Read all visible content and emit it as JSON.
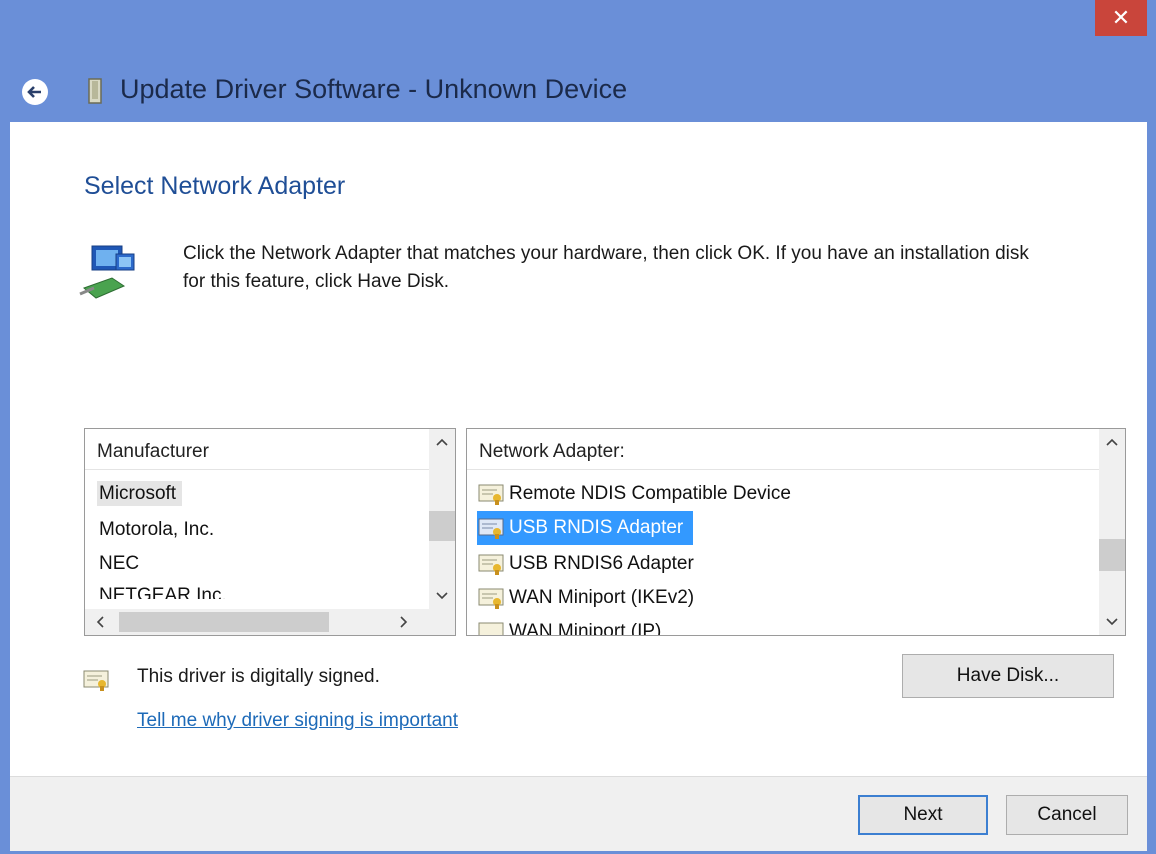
{
  "window": {
    "close_glyph": "✕",
    "title": "Update Driver Software - Unknown Device"
  },
  "page": {
    "heading": "Select Network Adapter",
    "description": "Click the Network Adapter that matches your hardware, then click OK. If you have an installation disk for this feature, click Have Disk."
  },
  "manufacturer_list": {
    "header": "Manufacturer",
    "items": [
      "Microsoft",
      "Motorola, Inc.",
      "NEC",
      "NETGEAR Inc."
    ],
    "selected": "Microsoft"
  },
  "adapter_list": {
    "header": "Network Adapter:",
    "items": [
      "Remote NDIS Compatible Device",
      "USB RNDIS Adapter",
      "USB RNDIS6 Adapter",
      "WAN Miniport (IKEv2)",
      "WAN Miniport (IP)"
    ],
    "selected": "USB RNDIS Adapter"
  },
  "signing": {
    "status": "This driver is digitally signed.",
    "link": "Tell me why driver signing is important"
  },
  "buttons": {
    "have_disk": "Have Disk...",
    "next": "Next",
    "cancel": "Cancel"
  },
  "colors": {
    "titlebar": "#6a8fd8",
    "close": "#c9453b",
    "heading": "#1f4e96",
    "selection": "#3399ff",
    "link": "#1d6ab8"
  }
}
